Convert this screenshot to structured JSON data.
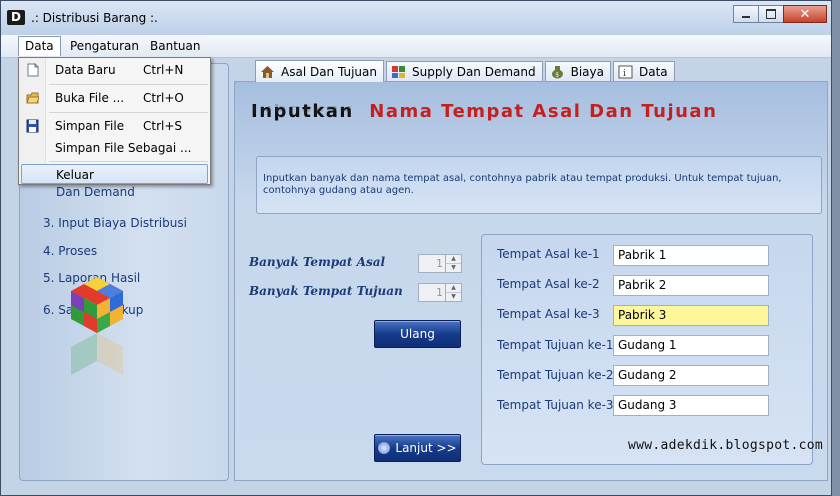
{
  "window": {
    "title": ".: Distribusi Barang :.",
    "icon_letter": "D"
  },
  "menu": [
    {
      "label": "Data"
    },
    {
      "label": "Pengaturan"
    },
    {
      "label": "Bantuan"
    }
  ],
  "dropdown": {
    "items": [
      {
        "label": "Data Baru",
        "shortcut": "Ctrl+N"
      },
      {
        "label": "Buka File ...",
        "shortcut": "Ctrl+O"
      },
      {
        "label": "Simpan File",
        "shortcut": "Ctrl+S"
      },
      {
        "label": "Simpan File Sebagai ...",
        "shortcut": ""
      },
      {
        "label": "Keluar",
        "shortcut": ""
      }
    ]
  },
  "sidebar": {
    "items": [
      {
        "label": "Dan Demand"
      },
      {
        "label": "3. Input Biaya Distribusi"
      },
      {
        "label": "4. Proses"
      },
      {
        "label": "5. Laporan Hasil"
      },
      {
        "label": "6. Save / Backup"
      }
    ]
  },
  "tabs": [
    {
      "label": "Asal Dan Tujuan"
    },
    {
      "label": "Supply Dan Demand"
    },
    {
      "label": "Biaya"
    },
    {
      "label": "Data"
    }
  ],
  "heading": {
    "part1": "Inputkan",
    "part2": "Nama Tempat Asal Dan Tujuan"
  },
  "info": "Inputkan banyak dan nama tempat asal, contohnya pabrik atau tempat produksi. Untuk tempat tujuan, contohnya gudang atau agen.",
  "counts": {
    "asal_label": "Banyak Tempat Asal",
    "asal_value": "1",
    "tujuan_label": "Banyak Tempat Tujuan",
    "tujuan_value": "1"
  },
  "buttons": {
    "ulang": "Ulang",
    "lanjut": "Lanjut >>"
  },
  "fields": [
    {
      "label": "Tempat Asal ke-1",
      "value": "Pabrik 1"
    },
    {
      "label": "Tempat Asal ke-2",
      "value": "Pabrik 2"
    },
    {
      "label": "Tempat Asal ke-3",
      "value": "Pabrik 3"
    },
    {
      "label": "Tempat Tujuan ke-1",
      "value": "Gudang 1"
    },
    {
      "label": "Tempat Tujuan ke-2",
      "value": "Gudang 2"
    },
    {
      "label": "Tempat Tujuan ke-3",
      "value": "Gudang 3"
    }
  ],
  "watermark": "www.adekdik.blogspot.com",
  "colors": {
    "heading_red": "#c42020",
    "field_highlight": "#fdf69a",
    "button_blue": "#173c8c"
  }
}
